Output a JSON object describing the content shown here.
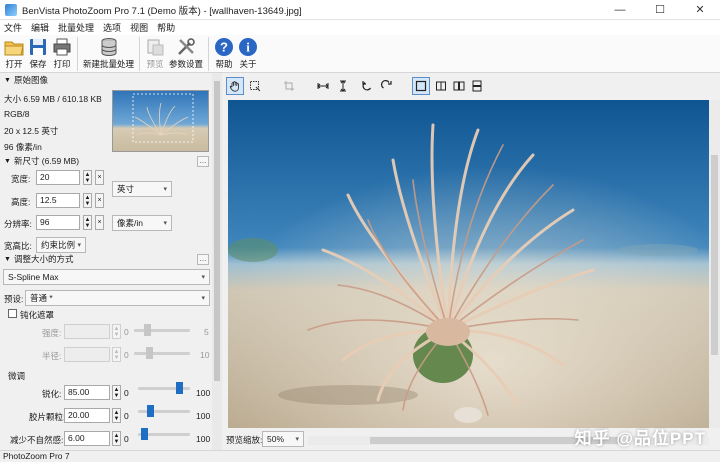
{
  "window": {
    "title": "BenVista PhotoZoom Pro 7.1 (Demo 版本) - [wallhaven-13649.jpg]",
    "minimize": "—",
    "maximize": "☐",
    "close": "✕"
  },
  "menu": [
    "文件",
    "编辑",
    "批量处理",
    "选项",
    "视图",
    "帮助"
  ],
  "toolbar": {
    "open": "打开",
    "save": "保存",
    "print": "打印",
    "batch": "新建批量处理",
    "preview": "预览",
    "settings": "参数设置",
    "help": "帮助",
    "about": "关于"
  },
  "original": {
    "header": "原始图像",
    "size": "大小 6.59 MB / 610.18 KB",
    "mode": "RGB/8",
    "dims": "20 x 12.5 英寸",
    "res": "96 像素/in"
  },
  "new_size": {
    "header": "新尺寸 (6.59 MB)",
    "width_label": "宽度:",
    "width_value": "20",
    "height_label": "高度:",
    "height_value": "12.5",
    "res_label": "分辨率:",
    "res_value": "96",
    "unit": "英寸",
    "res_unit": "像素/in",
    "aspect_label": "宽高比:",
    "aspect_value": "约束比例"
  },
  "resize": {
    "header": "调整大小的方式",
    "method": "S-Spline Max",
    "preset_label": "预设:",
    "preset_value": "普通 *",
    "sharpen_label": "钝化遮罩",
    "strength_label": "强度:",
    "strength_min": "0",
    "strength_max": "5",
    "radius_label": "半径:",
    "radius_min": "0",
    "radius_max": "10",
    "fine_tune": "微调",
    "sharpness_label": "锐化:",
    "sharpness_value": "85.00",
    "sharpness_min": "0",
    "sharpness_max": "100",
    "sharpness_level": 0.85,
    "grain_label": "胶片颗粒:",
    "grain_value": "20.00",
    "grain_min": "0",
    "grain_max": "100",
    "grain_level": 0.2,
    "artifact_label": "减少不自然感:",
    "artifact_value": "6.00",
    "artifact_min": "0",
    "artifact_max": "100",
    "artifact_level": 0.06
  },
  "view": {
    "zoom_label": "预览缩放:",
    "zoom_value": "50%"
  },
  "status": "PhotoZoom Pro 7",
  "watermark": "知乎 @品位PPT",
  "colors": {
    "accent": "#1e6fc4",
    "sea_top": "#1b5f9e",
    "sand": "#cbbfa8"
  }
}
